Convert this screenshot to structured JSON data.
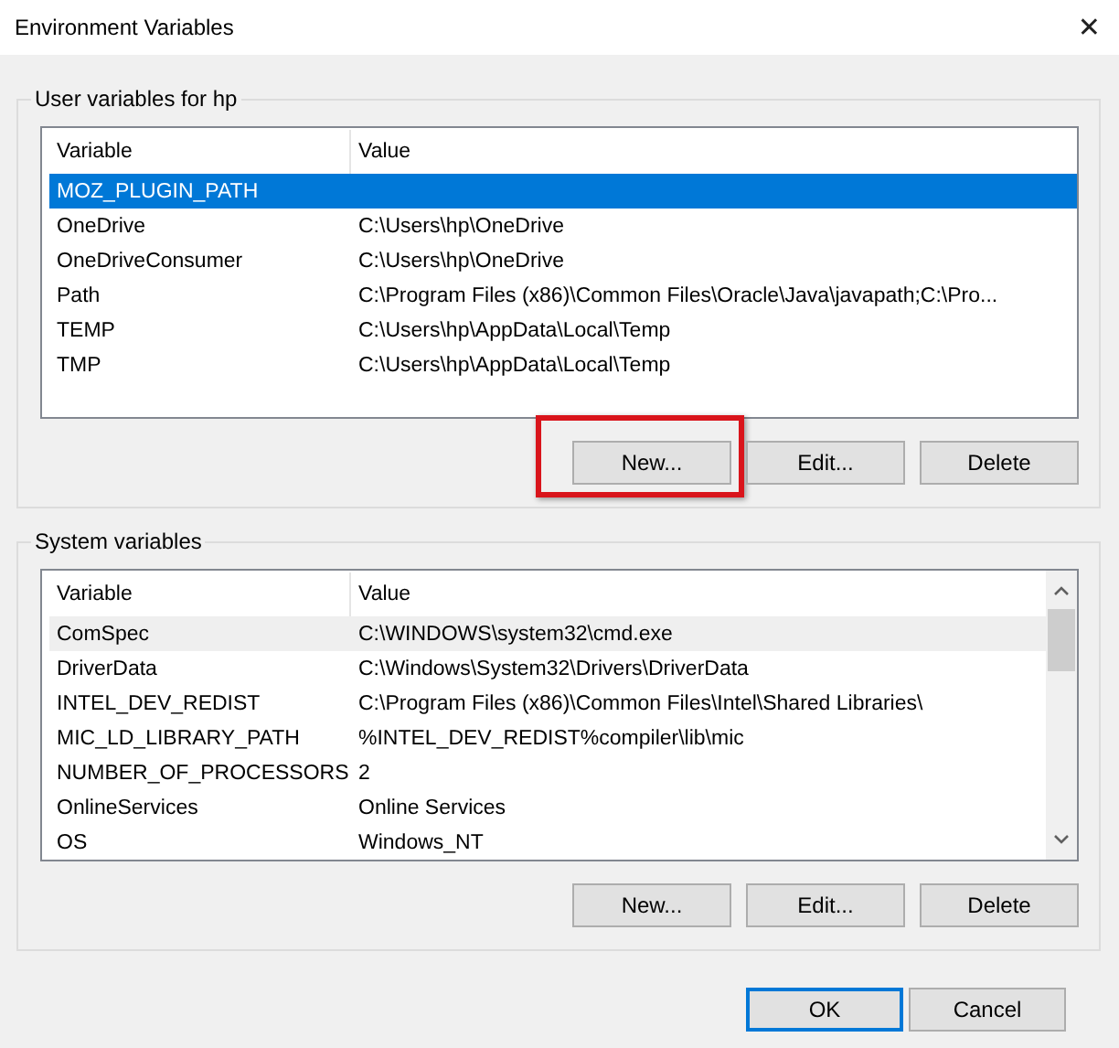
{
  "window": {
    "title": "Environment Variables",
    "close": "✕"
  },
  "groups": [
    {
      "title": "User variables for hp",
      "scrollbar": false,
      "columns": [
        "Variable",
        "Value"
      ],
      "rows": [
        {
          "variable": "MOZ_PLUGIN_PATH",
          "value": "",
          "selected": true,
          "hovered": false
        },
        {
          "variable": "OneDrive",
          "value": "C:\\Users\\hp\\OneDrive",
          "selected": false,
          "hovered": false
        },
        {
          "variable": "OneDriveConsumer",
          "value": "C:\\Users\\hp\\OneDrive",
          "selected": false,
          "hovered": false
        },
        {
          "variable": "Path",
          "value": "C:\\Program Files (x86)\\Common Files\\Oracle\\Java\\javapath;C:\\Pro...",
          "selected": false,
          "hovered": false
        },
        {
          "variable": "TEMP",
          "value": "C:\\Users\\hp\\AppData\\Local\\Temp",
          "selected": false,
          "hovered": false
        },
        {
          "variable": "TMP",
          "value": "C:\\Users\\hp\\AppData\\Local\\Temp",
          "selected": false,
          "hovered": false
        }
      ],
      "buttons": [
        {
          "label": "New...",
          "highlighted": true
        },
        {
          "label": "Edit...",
          "highlighted": false
        },
        {
          "label": "Delete",
          "highlighted": false
        }
      ]
    },
    {
      "title": "System variables",
      "scrollbar": true,
      "columns": [
        "Variable",
        "Value"
      ],
      "rows": [
        {
          "variable": "ComSpec",
          "value": "C:\\WINDOWS\\system32\\cmd.exe",
          "selected": false,
          "hovered": true
        },
        {
          "variable": "DriverData",
          "value": "C:\\Windows\\System32\\Drivers\\DriverData",
          "selected": false,
          "hovered": false
        },
        {
          "variable": "INTEL_DEV_REDIST",
          "value": "C:\\Program Files (x86)\\Common Files\\Intel\\Shared Libraries\\",
          "selected": false,
          "hovered": false
        },
        {
          "variable": "MIC_LD_LIBRARY_PATH",
          "value": "%INTEL_DEV_REDIST%compiler\\lib\\mic",
          "selected": false,
          "hovered": false
        },
        {
          "variable": "NUMBER_OF_PROCESSORS",
          "value": "2",
          "selected": false,
          "hovered": false
        },
        {
          "variable": "OnlineServices",
          "value": "Online Services",
          "selected": false,
          "hovered": false
        },
        {
          "variable": "OS",
          "value": "Windows_NT",
          "selected": false,
          "hovered": false
        }
      ],
      "buttons": [
        {
          "label": "New...",
          "highlighted": false
        },
        {
          "label": "Edit...",
          "highlighted": false
        },
        {
          "label": "Delete",
          "highlighted": false
        }
      ]
    }
  ],
  "dialog_buttons": [
    {
      "label": "OK",
      "default": true
    },
    {
      "label": "Cancel",
      "default": false
    }
  ]
}
